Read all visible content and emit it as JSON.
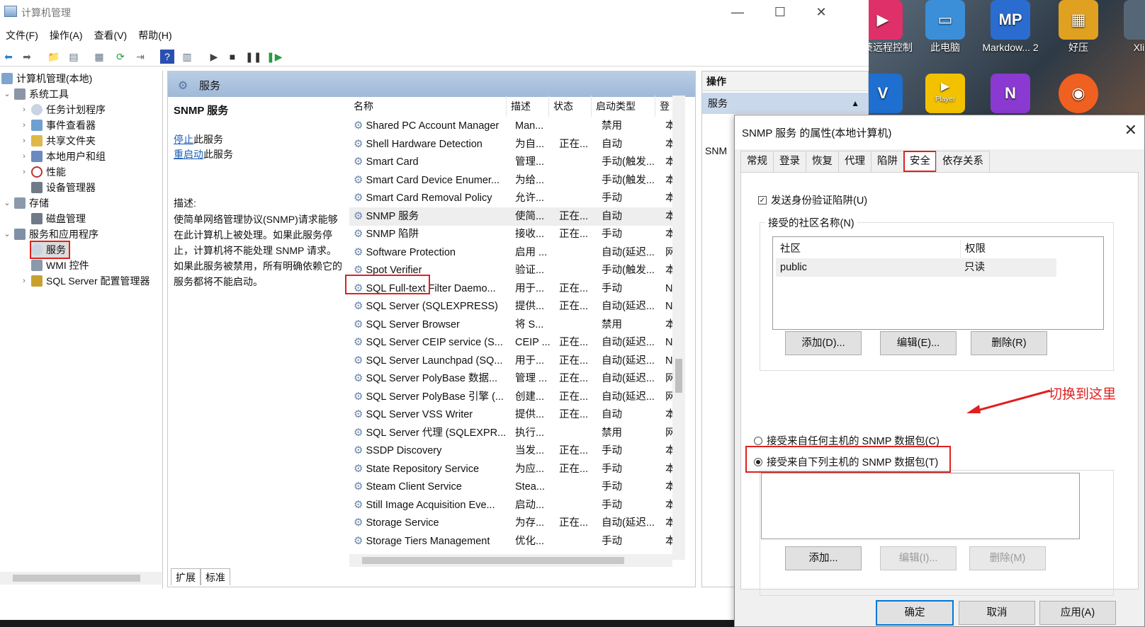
{
  "window": {
    "title": "计算机管理",
    "controls": {
      "minimize": "—",
      "maximize": "☐",
      "close": "✕"
    }
  },
  "menu": [
    "文件(F)",
    "操作(A)",
    "查看(V)",
    "帮助(H)"
  ],
  "tree": {
    "items": [
      {
        "label": "计算机管理(本地)",
        "icon": "computer-icon",
        "expander": ""
      },
      {
        "label": "系统工具",
        "icon": "tools-icon",
        "expander": "⌄"
      },
      {
        "label": "任务计划程序",
        "icon": "clock-icon",
        "expander": "›"
      },
      {
        "label": "事件查看器",
        "icon": "event-viewer-icon",
        "expander": "›"
      },
      {
        "label": "共享文件夹",
        "icon": "shared-folder-icon",
        "expander": "›"
      },
      {
        "label": "本地用户和组",
        "icon": "users-icon",
        "expander": "›"
      },
      {
        "label": "性能",
        "icon": "performance-icon",
        "expander": "›"
      },
      {
        "label": "设备管理器",
        "icon": "device-manager-icon",
        "expander": ""
      },
      {
        "label": "存储",
        "icon": "storage-icon",
        "expander": "⌄"
      },
      {
        "label": "磁盘管理",
        "icon": "disk-icon",
        "expander": ""
      },
      {
        "label": "服务和应用程序",
        "icon": "services-apps-icon",
        "expander": "⌄"
      },
      {
        "label": "服务",
        "icon": "gear-icon",
        "expander": ""
      },
      {
        "label": "WMI 控件",
        "icon": "wmi-icon",
        "expander": ""
      },
      {
        "label": "SQL Server 配置管理器",
        "icon": "sql-icon",
        "expander": "›"
      }
    ]
  },
  "center": {
    "header": "服务",
    "service_title": "SNMP 服务",
    "stop_link": "停止",
    "stop_suffix": "此服务",
    "restart_link": "重启动",
    "restart_suffix": "此服务",
    "desc_label": "描述:",
    "description": "使简单网络管理协议(SNMP)请求能够在此计算机上被处理。如果此服务停止，计算机将不能处理 SNMP 请求。如果此服务被禁用，所有明确依赖它的服务都将不能启动。",
    "columns": [
      "名称",
      "描述",
      "状态",
      "启动类型",
      "登"
    ],
    "rows": [
      {
        "name": "Shared PC Account Manager",
        "desc": "Man...",
        "status": "",
        "startup": "禁用",
        "logon": "本"
      },
      {
        "name": "Shell Hardware Detection",
        "desc": "为自...",
        "status": "正在...",
        "startup": "自动",
        "logon": "本"
      },
      {
        "name": "Smart Card",
        "desc": "管理...",
        "status": "",
        "startup": "手动(触发...",
        "logon": "本"
      },
      {
        "name": "Smart Card Device Enumer...",
        "desc": "为给...",
        "status": "",
        "startup": "手动(触发...",
        "logon": "本"
      },
      {
        "name": "Smart Card Removal Policy",
        "desc": "允许...",
        "status": "",
        "startup": "手动",
        "logon": "本"
      },
      {
        "name": "SNMP 服务",
        "desc": "使简...",
        "status": "正在...",
        "startup": "自动",
        "logon": "本"
      },
      {
        "name": "SNMP 陷阱",
        "desc": "接收...",
        "status": "正在...",
        "startup": "手动",
        "logon": "本"
      },
      {
        "name": "Software Protection",
        "desc": "启用 ...",
        "status": "",
        "startup": "自动(延迟...",
        "logon": "网"
      },
      {
        "name": "Spot Verifier",
        "desc": "验证...",
        "status": "",
        "startup": "手动(触发...",
        "logon": "本"
      },
      {
        "name": "SQL Full-text Filter Daemo...",
        "desc": "用于...",
        "status": "正在...",
        "startup": "手动",
        "logon": "N"
      },
      {
        "name": "SQL Server (SQLEXPRESS)",
        "desc": "提供...",
        "status": "正在...",
        "startup": "自动(延迟...",
        "logon": "N"
      },
      {
        "name": "SQL Server Browser",
        "desc": "将 S...",
        "status": "",
        "startup": "禁用",
        "logon": "本"
      },
      {
        "name": "SQL Server CEIP service (S...",
        "desc": "CEIP ...",
        "status": "正在...",
        "startup": "自动(延迟...",
        "logon": "N"
      },
      {
        "name": "SQL Server Launchpad (SQ...",
        "desc": "用于...",
        "status": "正在...",
        "startup": "自动(延迟...",
        "logon": "N"
      },
      {
        "name": "SQL Server PolyBase 数据...",
        "desc": "管理 ...",
        "status": "正在...",
        "startup": "自动(延迟...",
        "logon": "网"
      },
      {
        "name": "SQL Server PolyBase 引擎 (...",
        "desc": "创建...",
        "status": "正在...",
        "startup": "自动(延迟...",
        "logon": "网"
      },
      {
        "name": "SQL Server VSS Writer",
        "desc": "提供...",
        "status": "正在...",
        "startup": "自动",
        "logon": "本"
      },
      {
        "name": "SQL Server 代理 (SQLEXPR...",
        "desc": "执行...",
        "status": "",
        "startup": "禁用",
        "logon": "网"
      },
      {
        "name": "SSDP Discovery",
        "desc": "当发...",
        "status": "正在...",
        "startup": "手动",
        "logon": "本"
      },
      {
        "name": "State Repository Service",
        "desc": "为应...",
        "status": "正在...",
        "startup": "手动",
        "logon": "本"
      },
      {
        "name": "Steam Client Service",
        "desc": "Stea...",
        "status": "",
        "startup": "手动",
        "logon": "本"
      },
      {
        "name": "Still Image Acquisition Eve...",
        "desc": "启动...",
        "status": "",
        "startup": "手动",
        "logon": "本"
      },
      {
        "name": "Storage Service",
        "desc": "为存...",
        "status": "正在...",
        "startup": "自动(延迟...",
        "logon": "本"
      },
      {
        "name": "Storage Tiers Management",
        "desc": "优化...",
        "status": "",
        "startup": "手动",
        "logon": "本"
      }
    ],
    "tabs": [
      "扩展",
      "标准"
    ]
  },
  "actions": {
    "header": "操作",
    "section": "服务",
    "item": "SNM"
  },
  "desktop": {
    "icons": [
      {
        "label": "日葵远程控制",
        "icon": "remote-control-icon",
        "color": "#e0306a",
        "glyph": "▶"
      },
      {
        "label": "此电脑",
        "icon": "this-pc-icon",
        "color": "#3a8fd8",
        "glyph": "▭"
      },
      {
        "label": "Markdow... 2",
        "icon": "markdown-icon",
        "color": "#2a6ccf",
        "glyph": "MP"
      },
      {
        "label": "好压",
        "icon": "haozip-icon",
        "color": "#e0a020",
        "glyph": "▦"
      },
      {
        "label": "Xli S",
        "icon": "app-icon",
        "color": "#556677",
        "glyph": ""
      },
      {
        "label": "",
        "icon": "v-app-icon",
        "color": "#1e6fd0",
        "glyph": "V"
      },
      {
        "label": "",
        "icon": "player-icon",
        "color": "#f2c200",
        "glyph": "▶"
      },
      {
        "label": "",
        "icon": "onenote-icon",
        "color": "#8a3ad0",
        "glyph": "N"
      },
      {
        "label": "",
        "icon": "firefox-icon",
        "color": "#f06020",
        "glyph": "◉"
      }
    ],
    "player_caption": "Player"
  },
  "dialog": {
    "title": "SNMP 服务 的属性(本地计算机)",
    "tabs": [
      "常规",
      "登录",
      "恢复",
      "代理",
      "陷阱",
      "安全",
      "依存关系"
    ],
    "active_tab": "安全",
    "send_auth_trap": "发送身份验证陷阱(U)",
    "accepted_communities_label": "接受的社区名称(N)",
    "community_columns": [
      "社区",
      "权限"
    ],
    "communities": [
      {
        "name": "public",
        "rights": "只读"
      }
    ],
    "add1": "添加(D)...",
    "edit1": "编辑(E)...",
    "remove1": "删除(R)",
    "radio_any": "接受来自任何主机的 SNMP 数据包(C)",
    "radio_list": "接受来自下列主机的 SNMP 数据包(T)",
    "add2": "添加...",
    "edit2": "编辑(I)...",
    "remove2": "删除(M)",
    "ok": "确定",
    "cancel": "取消",
    "apply": "应用(A)",
    "annotation": "切换到这里"
  },
  "colors": {
    "highlight": "#e02020",
    "link": "#1a5fb4",
    "header": "#b9cde4"
  }
}
